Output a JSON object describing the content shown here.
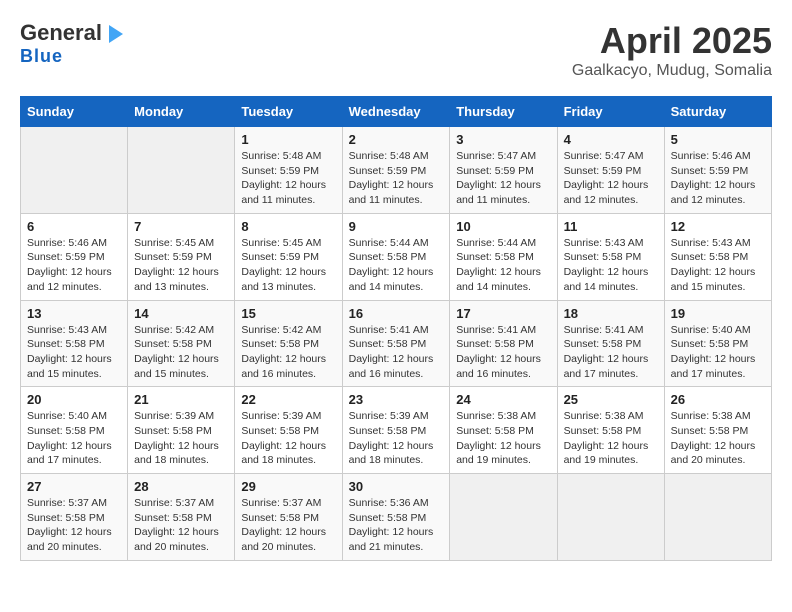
{
  "header": {
    "logo_general": "General",
    "logo_blue": "Blue",
    "title": "April 2025",
    "subtitle": "Gaalkacyo, Mudug, Somalia"
  },
  "days_of_week": [
    "Sunday",
    "Monday",
    "Tuesday",
    "Wednesday",
    "Thursday",
    "Friday",
    "Saturday"
  ],
  "weeks": [
    [
      {
        "day": "",
        "info": ""
      },
      {
        "day": "",
        "info": ""
      },
      {
        "day": "1",
        "info": "Sunrise: 5:48 AM\nSunset: 5:59 PM\nDaylight: 12 hours and 11 minutes."
      },
      {
        "day": "2",
        "info": "Sunrise: 5:48 AM\nSunset: 5:59 PM\nDaylight: 12 hours and 11 minutes."
      },
      {
        "day": "3",
        "info": "Sunrise: 5:47 AM\nSunset: 5:59 PM\nDaylight: 12 hours and 11 minutes."
      },
      {
        "day": "4",
        "info": "Sunrise: 5:47 AM\nSunset: 5:59 PM\nDaylight: 12 hours and 12 minutes."
      },
      {
        "day": "5",
        "info": "Sunrise: 5:46 AM\nSunset: 5:59 PM\nDaylight: 12 hours and 12 minutes."
      }
    ],
    [
      {
        "day": "6",
        "info": "Sunrise: 5:46 AM\nSunset: 5:59 PM\nDaylight: 12 hours and 12 minutes."
      },
      {
        "day": "7",
        "info": "Sunrise: 5:45 AM\nSunset: 5:59 PM\nDaylight: 12 hours and 13 minutes."
      },
      {
        "day": "8",
        "info": "Sunrise: 5:45 AM\nSunset: 5:59 PM\nDaylight: 12 hours and 13 minutes."
      },
      {
        "day": "9",
        "info": "Sunrise: 5:44 AM\nSunset: 5:58 PM\nDaylight: 12 hours and 14 minutes."
      },
      {
        "day": "10",
        "info": "Sunrise: 5:44 AM\nSunset: 5:58 PM\nDaylight: 12 hours and 14 minutes."
      },
      {
        "day": "11",
        "info": "Sunrise: 5:43 AM\nSunset: 5:58 PM\nDaylight: 12 hours and 14 minutes."
      },
      {
        "day": "12",
        "info": "Sunrise: 5:43 AM\nSunset: 5:58 PM\nDaylight: 12 hours and 15 minutes."
      }
    ],
    [
      {
        "day": "13",
        "info": "Sunrise: 5:43 AM\nSunset: 5:58 PM\nDaylight: 12 hours and 15 minutes."
      },
      {
        "day": "14",
        "info": "Sunrise: 5:42 AM\nSunset: 5:58 PM\nDaylight: 12 hours and 15 minutes."
      },
      {
        "day": "15",
        "info": "Sunrise: 5:42 AM\nSunset: 5:58 PM\nDaylight: 12 hours and 16 minutes."
      },
      {
        "day": "16",
        "info": "Sunrise: 5:41 AM\nSunset: 5:58 PM\nDaylight: 12 hours and 16 minutes."
      },
      {
        "day": "17",
        "info": "Sunrise: 5:41 AM\nSunset: 5:58 PM\nDaylight: 12 hours and 16 minutes."
      },
      {
        "day": "18",
        "info": "Sunrise: 5:41 AM\nSunset: 5:58 PM\nDaylight: 12 hours and 17 minutes."
      },
      {
        "day": "19",
        "info": "Sunrise: 5:40 AM\nSunset: 5:58 PM\nDaylight: 12 hours and 17 minutes."
      }
    ],
    [
      {
        "day": "20",
        "info": "Sunrise: 5:40 AM\nSunset: 5:58 PM\nDaylight: 12 hours and 17 minutes."
      },
      {
        "day": "21",
        "info": "Sunrise: 5:39 AM\nSunset: 5:58 PM\nDaylight: 12 hours and 18 minutes."
      },
      {
        "day": "22",
        "info": "Sunrise: 5:39 AM\nSunset: 5:58 PM\nDaylight: 12 hours and 18 minutes."
      },
      {
        "day": "23",
        "info": "Sunrise: 5:39 AM\nSunset: 5:58 PM\nDaylight: 12 hours and 18 minutes."
      },
      {
        "day": "24",
        "info": "Sunrise: 5:38 AM\nSunset: 5:58 PM\nDaylight: 12 hours and 19 minutes."
      },
      {
        "day": "25",
        "info": "Sunrise: 5:38 AM\nSunset: 5:58 PM\nDaylight: 12 hours and 19 minutes."
      },
      {
        "day": "26",
        "info": "Sunrise: 5:38 AM\nSunset: 5:58 PM\nDaylight: 12 hours and 20 minutes."
      }
    ],
    [
      {
        "day": "27",
        "info": "Sunrise: 5:37 AM\nSunset: 5:58 PM\nDaylight: 12 hours and 20 minutes."
      },
      {
        "day": "28",
        "info": "Sunrise: 5:37 AM\nSunset: 5:58 PM\nDaylight: 12 hours and 20 minutes."
      },
      {
        "day": "29",
        "info": "Sunrise: 5:37 AM\nSunset: 5:58 PM\nDaylight: 12 hours and 20 minutes."
      },
      {
        "day": "30",
        "info": "Sunrise: 5:36 AM\nSunset: 5:58 PM\nDaylight: 12 hours and 21 minutes."
      },
      {
        "day": "",
        "info": ""
      },
      {
        "day": "",
        "info": ""
      },
      {
        "day": "",
        "info": ""
      }
    ]
  ]
}
